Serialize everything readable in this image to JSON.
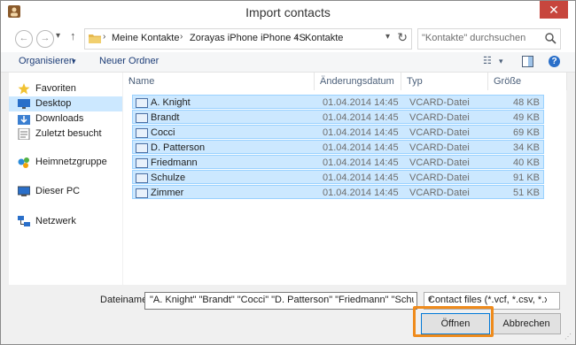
{
  "window": {
    "title": "Import contacts",
    "close_glyph": "✕"
  },
  "nav": {
    "back_glyph": "←",
    "forward_glyph": "→",
    "recent_glyph": "▾",
    "up_glyph": "↑",
    "breadcrumbs": [
      "Meine Kontakte",
      "Zorayas iPhone iPhone 4S",
      "Kontakte"
    ],
    "crumb_sep": "›",
    "dropdown_glyph": "▾",
    "refresh_glyph": "↻"
  },
  "search": {
    "placeholder": "\"Kontakte\" durchsuchen"
  },
  "toolbar": {
    "organize_label": "Organisieren",
    "organize_arrow": "▾",
    "new_folder_label": "Neuer Ordner",
    "view_glyph": "☷",
    "view_arrow": "▾",
    "help_glyph": "?"
  },
  "sidebar": {
    "favorites": "Favoriten",
    "items": [
      "Desktop",
      "Downloads",
      "Zuletzt besucht"
    ],
    "homegroup": "Heimnetzgruppe",
    "thispc": "Dieser PC",
    "network": "Netzwerk"
  },
  "columns": {
    "name": "Name",
    "date": "Änderungsdatum",
    "type": "Typ",
    "size": "Größe",
    "sort_glyph": "^"
  },
  "files": [
    {
      "name": "A. Knight",
      "date": "01.04.2014 14:45",
      "type": "VCARD-Datei",
      "size": "48 KB"
    },
    {
      "name": "Brandt",
      "date": "01.04.2014 14:45",
      "type": "VCARD-Datei",
      "size": "49 KB"
    },
    {
      "name": "Cocci",
      "date": "01.04.2014 14:45",
      "type": "VCARD-Datei",
      "size": "69 KB"
    },
    {
      "name": "D. Patterson",
      "date": "01.04.2014 14:45",
      "type": "VCARD-Datei",
      "size": "34 KB"
    },
    {
      "name": "Friedmann",
      "date": "01.04.2014 14:45",
      "type": "VCARD-Datei",
      "size": "40 KB"
    },
    {
      "name": "Schulze",
      "date": "01.04.2014 14:45",
      "type": "VCARD-Datei",
      "size": "91 KB"
    },
    {
      "name": "Zimmer",
      "date": "01.04.2014 14:45",
      "type": "VCARD-Datei",
      "size": "51 KB"
    }
  ],
  "bottom": {
    "filename_label": "Dateiname:",
    "filename_value": "\"A. Knight\" \"Brandt\" \"Cocci\" \"D. Patterson\" \"Friedmann\" \"Schulze\"",
    "filetype_value": "Contact files (*.vcf, *.csv, *.xls, *",
    "filetype_arrow": "▾",
    "open_label": "Öffnen",
    "cancel_label": "Abbrechen",
    "grip_glyph": "⋰"
  },
  "colors": {
    "selection": "#cce8ff",
    "selection_border": "#99d1ff",
    "highlight": "#ef8b1c",
    "close": "#c7463d"
  }
}
